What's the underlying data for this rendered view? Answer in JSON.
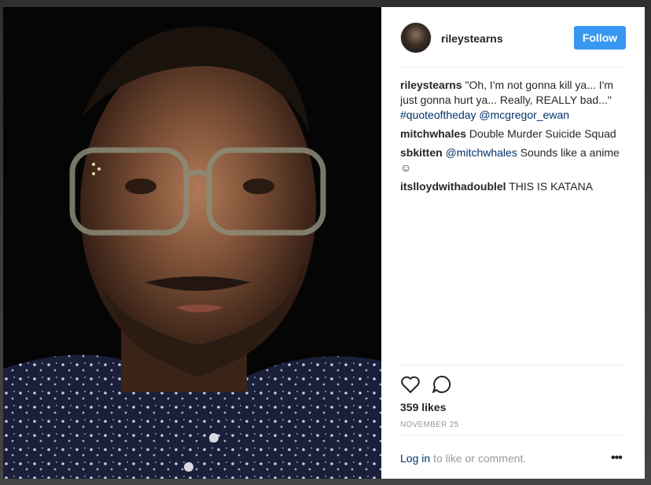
{
  "post": {
    "author": "rileystearns",
    "follow_label": "Follow",
    "caption": {
      "user": "rileystearns",
      "text": "\"Oh, I'm not gonna kill ya... I'm just gonna hurt ya... Really, REALLY bad...\"",
      "hashtag": "#quoteoftheday",
      "mention": "@mcgregor_ewan"
    },
    "comments": [
      {
        "user": "mitchwhales",
        "text": "Double Murder Suicide Squad"
      },
      {
        "user": "sbkitten",
        "mention": "@mitchwhales",
        "text": "Sounds like a anime ☺"
      },
      {
        "user": "itslloydwithadoublel",
        "text": "THIS IS KATANA"
      }
    ],
    "likes": "359 likes",
    "date": "NOVEMBER 25",
    "footer": {
      "login_link": "Log in",
      "login_text": "to like or comment.",
      "more": "•••"
    }
  },
  "icons": {
    "like": "heart-icon",
    "comment": "speech-bubble-icon",
    "more": "more-options-icon"
  },
  "colors": {
    "follow_button": "#3897f0",
    "link": "#003569",
    "text": "#262626",
    "muted": "#999999"
  }
}
